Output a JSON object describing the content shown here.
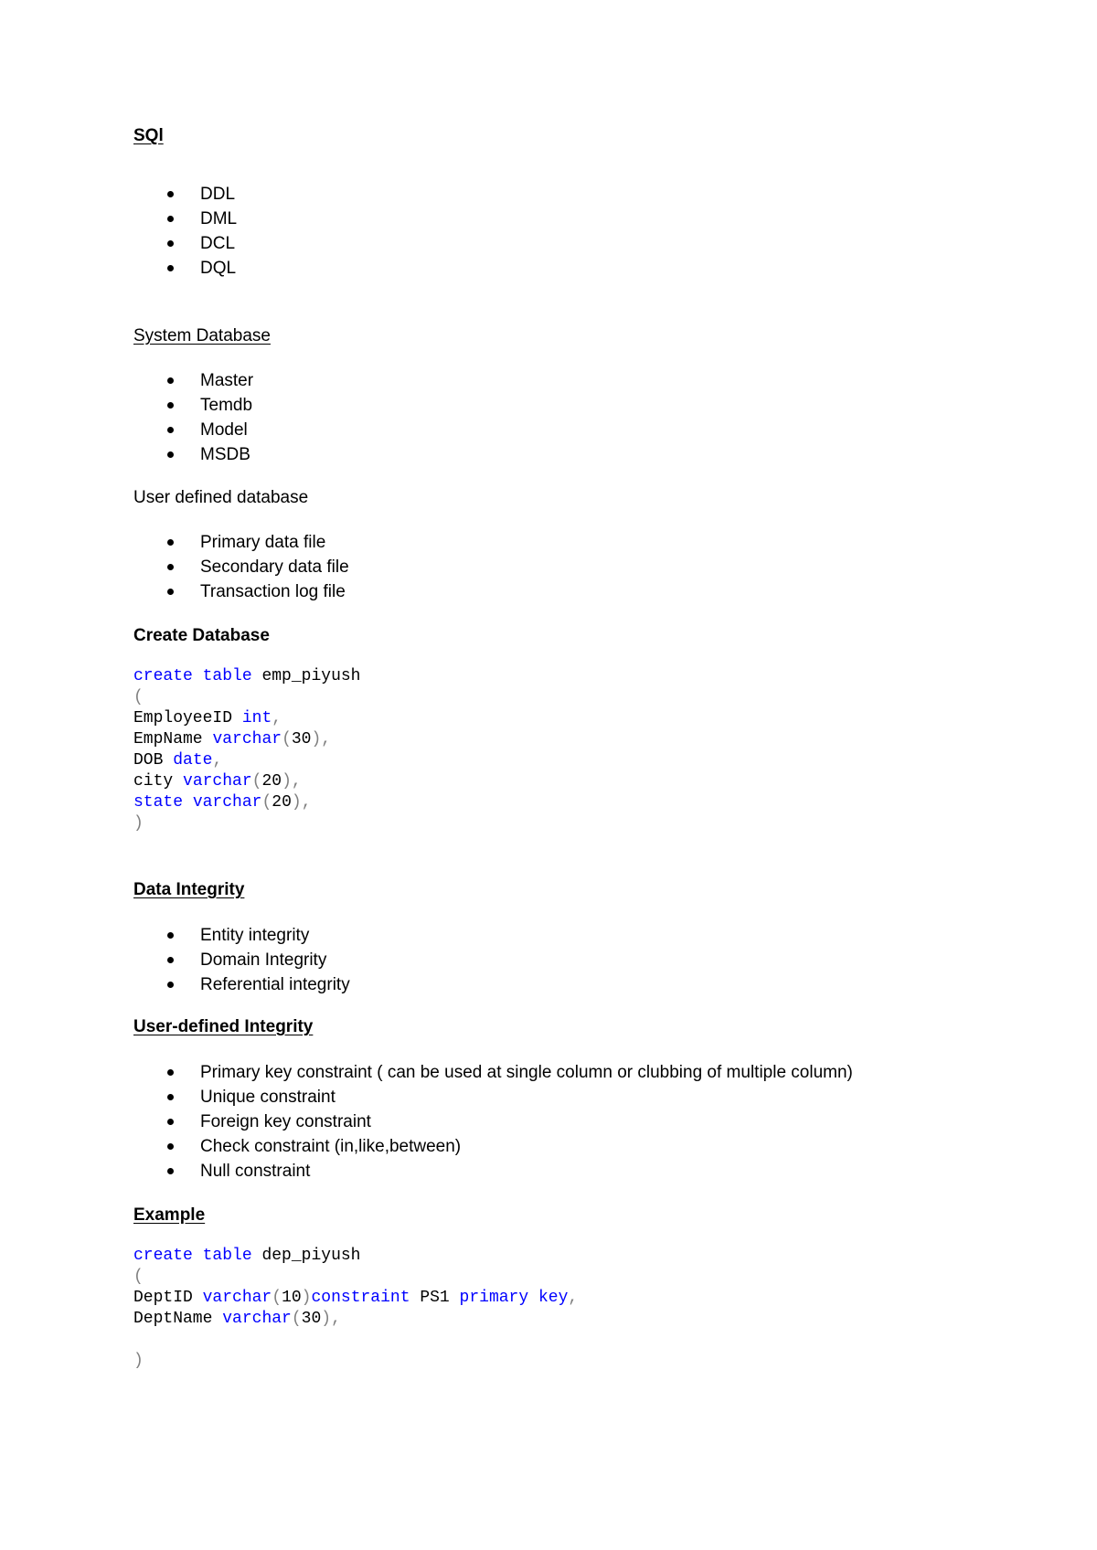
{
  "sql_section": {
    "heading": "SQl",
    "items": [
      "DDL",
      "DML",
      "DCL",
      "DQL"
    ]
  },
  "system_db_section": {
    "heading": "System Database",
    "items": [
      "Master",
      "Temdb",
      "Model",
      "MSDB"
    ]
  },
  "user_db_section": {
    "heading": "User defined database",
    "items": [
      "Primary data file",
      "Secondary data file",
      "Transaction log file"
    ]
  },
  "create_db_section": {
    "heading": "Create Database",
    "code": {
      "line1": {
        "kw1": "create",
        "kw2": "table",
        "name": "emp_piyush"
      },
      "line2": {
        "open": "("
      },
      "line3": {
        "col": "EmployeeID",
        "type": "int",
        "punct": ","
      },
      "line4": {
        "col": "EmpName",
        "type": "varchar",
        "open": "(",
        "size": "30",
        "close": ")",
        "punct": ","
      },
      "line5": {
        "col": "DOB",
        "type": "date",
        "punct": ","
      },
      "line6": {
        "col": "city",
        "type": "varchar",
        "open": "(",
        "size": "20",
        "close": ")",
        "punct": ","
      },
      "line7": {
        "col": "state",
        "type": "varchar",
        "open": "(",
        "size": "20",
        "close": ")",
        "punct": ","
      },
      "line8": {
        "close": ")"
      }
    }
  },
  "data_integrity_section": {
    "heading": "Data Integrity",
    "items": [
      "Entity integrity",
      "Domain Integrity",
      "Referential integrity"
    ]
  },
  "user_integrity_section": {
    "heading": "User-defined Integrity",
    "items": [
      "Primary key constraint ( can be used at single column or clubbing of multiple column)",
      "Unique constraint",
      "Foreign key constraint",
      "Check constraint (in,like,between)",
      "Null constraint"
    ]
  },
  "example_section": {
    "heading": "Example",
    "code": {
      "line1": {
        "kw1": "create",
        "kw2": "table",
        "name": "dep_piyush"
      },
      "line2": {
        "open": "("
      },
      "line3": {
        "col": "DeptID",
        "type": "varchar",
        "open": "(",
        "size": "10",
        "close": ")",
        "kw3": "constraint",
        "cname": "PS1",
        "kw4": "primary",
        "kw5": "key",
        "punct": ","
      },
      "line4": {
        "col": "DeptName",
        "type": "varchar",
        "open": "(",
        "size": "30",
        "close": ")",
        "punct": ","
      },
      "line5": {
        "close": ")"
      }
    }
  },
  "colors": {
    "keyword": "#0000ff",
    "identifier": "#000000",
    "punctuation": "#808080",
    "text": "#000000"
  }
}
